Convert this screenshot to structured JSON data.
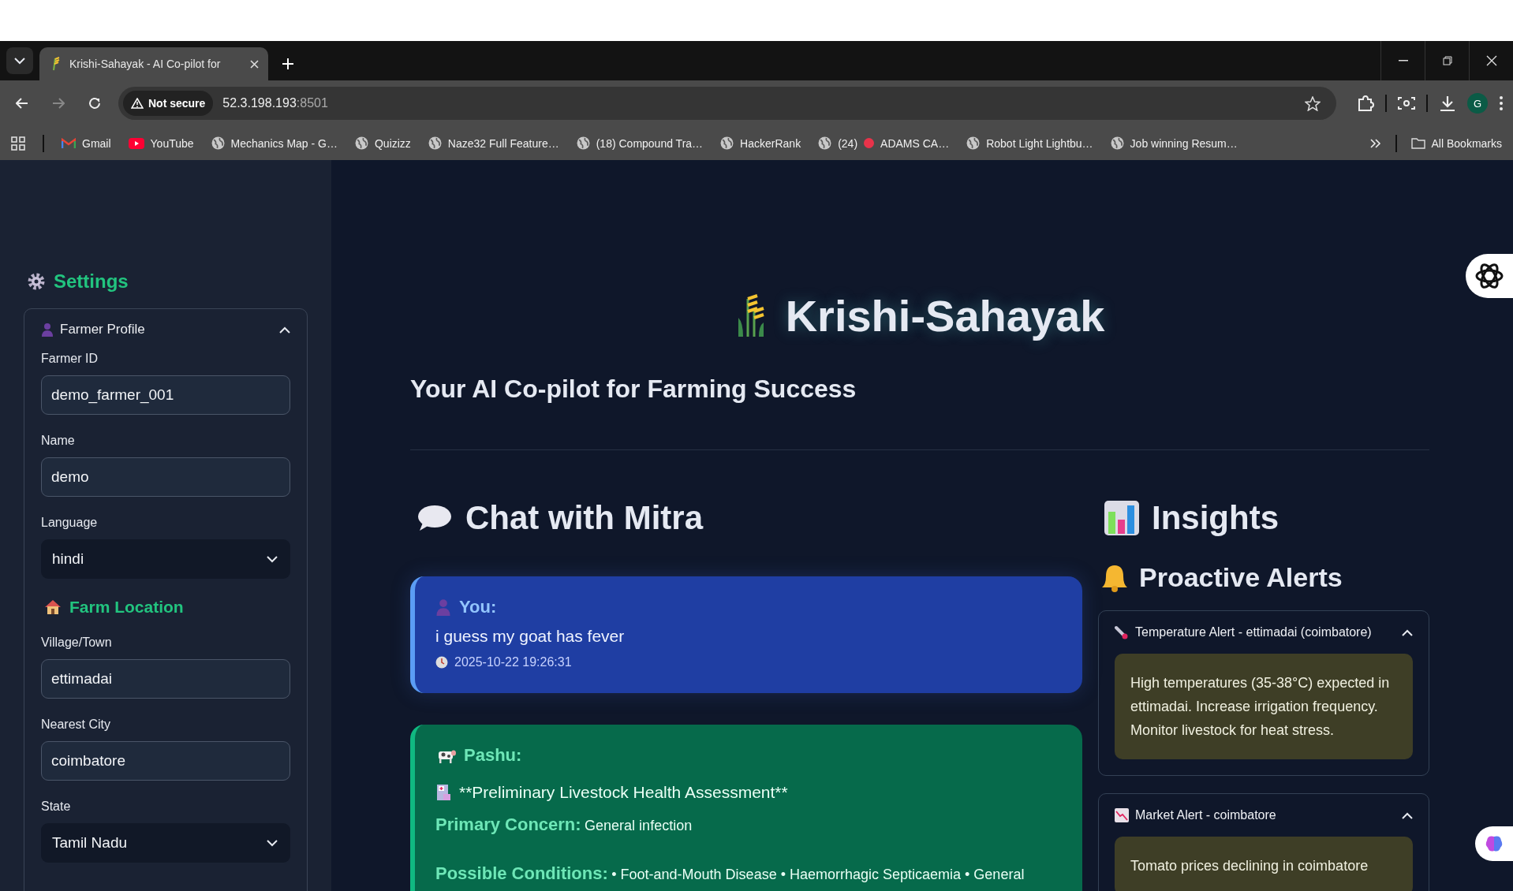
{
  "browser": {
    "tabs": [
      {
        "title": "Krishi-Sahayak - AI Co-pilot for",
        "selected": true
      }
    ],
    "address": {
      "security": "Not secure",
      "host": "52.3.198.193",
      "port": ":8501"
    },
    "profile_initial": "G",
    "bookmarks": [
      {
        "kind": "mail",
        "label": "Gmail"
      },
      {
        "kind": "video",
        "label": "YouTube"
      },
      {
        "kind": "site",
        "label": "Mechanics Map - G…"
      },
      {
        "kind": "site",
        "label": "Quizizz"
      },
      {
        "kind": "site",
        "label": "Naze32 Full Feature…"
      },
      {
        "kind": "site",
        "label": "(18) Compound Tra…"
      },
      {
        "kind": "site",
        "label": "HackerRank"
      },
      {
        "kind": "site",
        "prefix": "(24)",
        "label": "ADAMS CA…"
      },
      {
        "kind": "site",
        "label": "Robot Light Lightbu…"
      },
      {
        "kind": "site",
        "label": "Job winning Resum…"
      }
    ],
    "all_bookmarks": "All Bookmarks"
  },
  "sidebar": {
    "heading": "Settings",
    "profile": {
      "title": "Farmer Profile",
      "expanded": true,
      "fields": [
        {
          "kind": "text",
          "label": "Farmer ID",
          "value": "demo_farmer_001"
        },
        {
          "kind": "text",
          "label": "Name",
          "value": "demo"
        },
        {
          "kind": "select",
          "label": "Language",
          "value": "hindi"
        }
      ]
    },
    "location_heading": "Farm Location",
    "location_fields": [
      {
        "kind": "text",
        "label": "Village/Town",
        "value": "ettimadai"
      },
      {
        "kind": "text",
        "label": "Nearest City",
        "value": "coimbatore"
      },
      {
        "kind": "select",
        "label": "State",
        "value": "Tamil Nadu"
      }
    ]
  },
  "main": {
    "title": "Krishi-Sahayak",
    "subtitle": "Your AI Co-pilot for Farming Success",
    "chat": {
      "heading": "Chat with Mitra",
      "messages": [
        {
          "kind": "user",
          "sender": "You:",
          "text": "i guess my goat has fever",
          "time": "2025-10-22 19:26:31"
        },
        {
          "kind": "bot",
          "sender": "Pashu:",
          "items": [
            {
              "kind": "note",
              "text": "**Preliminary Livestock Health Assessment**"
            },
            {
              "kind": "field",
              "label": "Primary Concern:",
              "value": "General infection"
            },
            {
              "kind": "field",
              "label": "Possible Conditions:",
              "value": "• Foot-and-Mouth Disease • Haemorrhagic Septicaemia • General"
            }
          ]
        }
      ]
    },
    "insights": {
      "heading": "Insights",
      "alerts_heading": "Proactive Alerts",
      "alerts": [
        {
          "kind": "temperature",
          "title": "Temperature Alert - ettimadai (coimbatore)",
          "expanded": true,
          "text": "High temperatures (35-38°C) expected in ettimadai. Increase irrigation frequency. Monitor livestock for heat stress."
        },
        {
          "kind": "market",
          "title": "Market Alert - coimbatore",
          "expanded": true,
          "text": "Tomato prices declining in coimbatore"
        }
      ]
    }
  }
}
